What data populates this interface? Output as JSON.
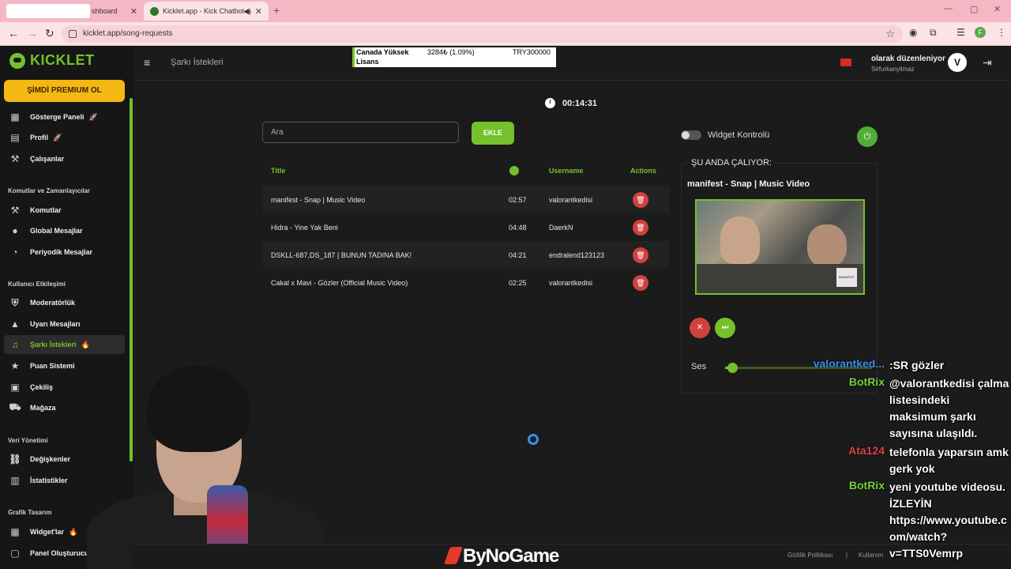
{
  "browser": {
    "tab1_label": "shboard",
    "tab2_label": "Kicklet.app - Kick Chatbot a",
    "url": "kicklet.app/song-requests",
    "profile_initial": "F"
  },
  "sidebar": {
    "brand": "KICKLET",
    "premium": "ŞİMDİ PREMIUM OL",
    "items": [
      {
        "label": "Gösterge Paneli",
        "icon": "dashboard-icon",
        "badge": "🚀"
      },
      {
        "label": "Profil",
        "icon": "profile-icon",
        "badge": "🚀"
      },
      {
        "label": "Çalışanlar",
        "icon": "workers-icon",
        "badge": ""
      },
      {
        "label": "Komutlar",
        "icon": "hammer-icon",
        "badge": ""
      },
      {
        "label": "Global Mesajlar",
        "icon": "chat-icon",
        "badge": ""
      },
      {
        "label": "Periyodik Mesajlar",
        "icon": "clock-icon",
        "badge": ""
      },
      {
        "label": "Moderatörlük",
        "icon": "shield-icon",
        "badge": ""
      },
      {
        "label": "Uyarı Mesajları",
        "icon": "warning-icon",
        "badge": ""
      },
      {
        "label": "Şarkı İstekleri",
        "icon": "music-icon",
        "badge": "🔥"
      },
      {
        "label": "Puan Sistemi",
        "icon": "star-icon",
        "badge": ""
      },
      {
        "label": "Çekiliş",
        "icon": "gift-icon",
        "badge": ""
      },
      {
        "label": "Mağaza",
        "icon": "cart-icon",
        "badge": ""
      },
      {
        "label": "Değişkenler",
        "icon": "link-icon",
        "badge": ""
      },
      {
        "label": "İstatistikler",
        "icon": "stats-icon",
        "badge": ""
      },
      {
        "label": "Widget'lar",
        "icon": "widget-icon",
        "badge": "🔥"
      },
      {
        "label": "Panel Oluşturucu",
        "icon": "panel-icon",
        "badge": ""
      }
    ],
    "sections": [
      "Komutlar ve Zamanlayıcılar",
      "Kullanıcı Etkileşimi",
      "Veri Yönetimi",
      "Grafik Tasarım"
    ]
  },
  "header": {
    "title": "Şarkı İstekleri",
    "ticker": {
      "line1": "Canada Yüksek",
      "line2": "Lisans",
      "price": "3284₺ (1.09%)",
      "amount": "TRY300000"
    },
    "user_name": "olarak düzenleniyor",
    "user_sub": "Sirfurkanyilmaz"
  },
  "timer": "00:14:31",
  "search": {
    "placeholder": "Ara"
  },
  "add_label": "EKLE",
  "table": {
    "headers": {
      "title": "Title",
      "username": "Username",
      "actions": "Actions"
    },
    "rows": [
      {
        "title": "manifest - Snap | Music Video",
        "duration": "02:57",
        "username": "valorantkedisi"
      },
      {
        "title": "Hidra - Yine Yak Beni",
        "duration": "04:48",
        "username": "DaerkN"
      },
      {
        "title": "DSKLL-687,DS_187 | BUNUN TADINA BAK!",
        "duration": "04:21",
        "username": "endralend123123"
      },
      {
        "title": "Cakal x Mavi - Gözler (Official Music Video)",
        "duration": "02:25",
        "username": "valorantkedisi"
      }
    ]
  },
  "widget": {
    "control_label": "Widget Kontrolü",
    "now_playing_label": "ŞU ANDA ÇALIYOR:",
    "now_playing_title": "manifest - Snap | Music Video",
    "video_watermark": "MANIFEST",
    "volume_label": "Ses",
    "volume_fraction": 0.05
  },
  "footer": {
    "brand": "ByNoGame",
    "privacy": "Gizlilik Politikası",
    "separator": "|",
    "terms": "Kullanım"
  },
  "chat": [
    {
      "nick": "valorantked...",
      "nick_color": "#3b8ee8",
      "lines": [
        ":SR gözler"
      ]
    },
    {
      "nick": "BotRix",
      "nick_color": "#74d13b",
      "lines": [
        "@valorantkedisi çalma",
        "listesindeki",
        "maksimum şarkı",
        "sayısına ulaşıldı."
      ]
    },
    {
      "nick": "Ata124",
      "nick_color": "#e0424a",
      "lines": [
        "telefonla yaparsın amk",
        "gerk yok"
      ]
    },
    {
      "nick": "BotRix",
      "nick_color": "#74d13b",
      "lines": [
        "yeni youtube videosu.",
        "İZLEYİN",
        "https://www.youtube.c",
        "om/watch?",
        "v=TTS0Vemrp"
      ]
    }
  ]
}
